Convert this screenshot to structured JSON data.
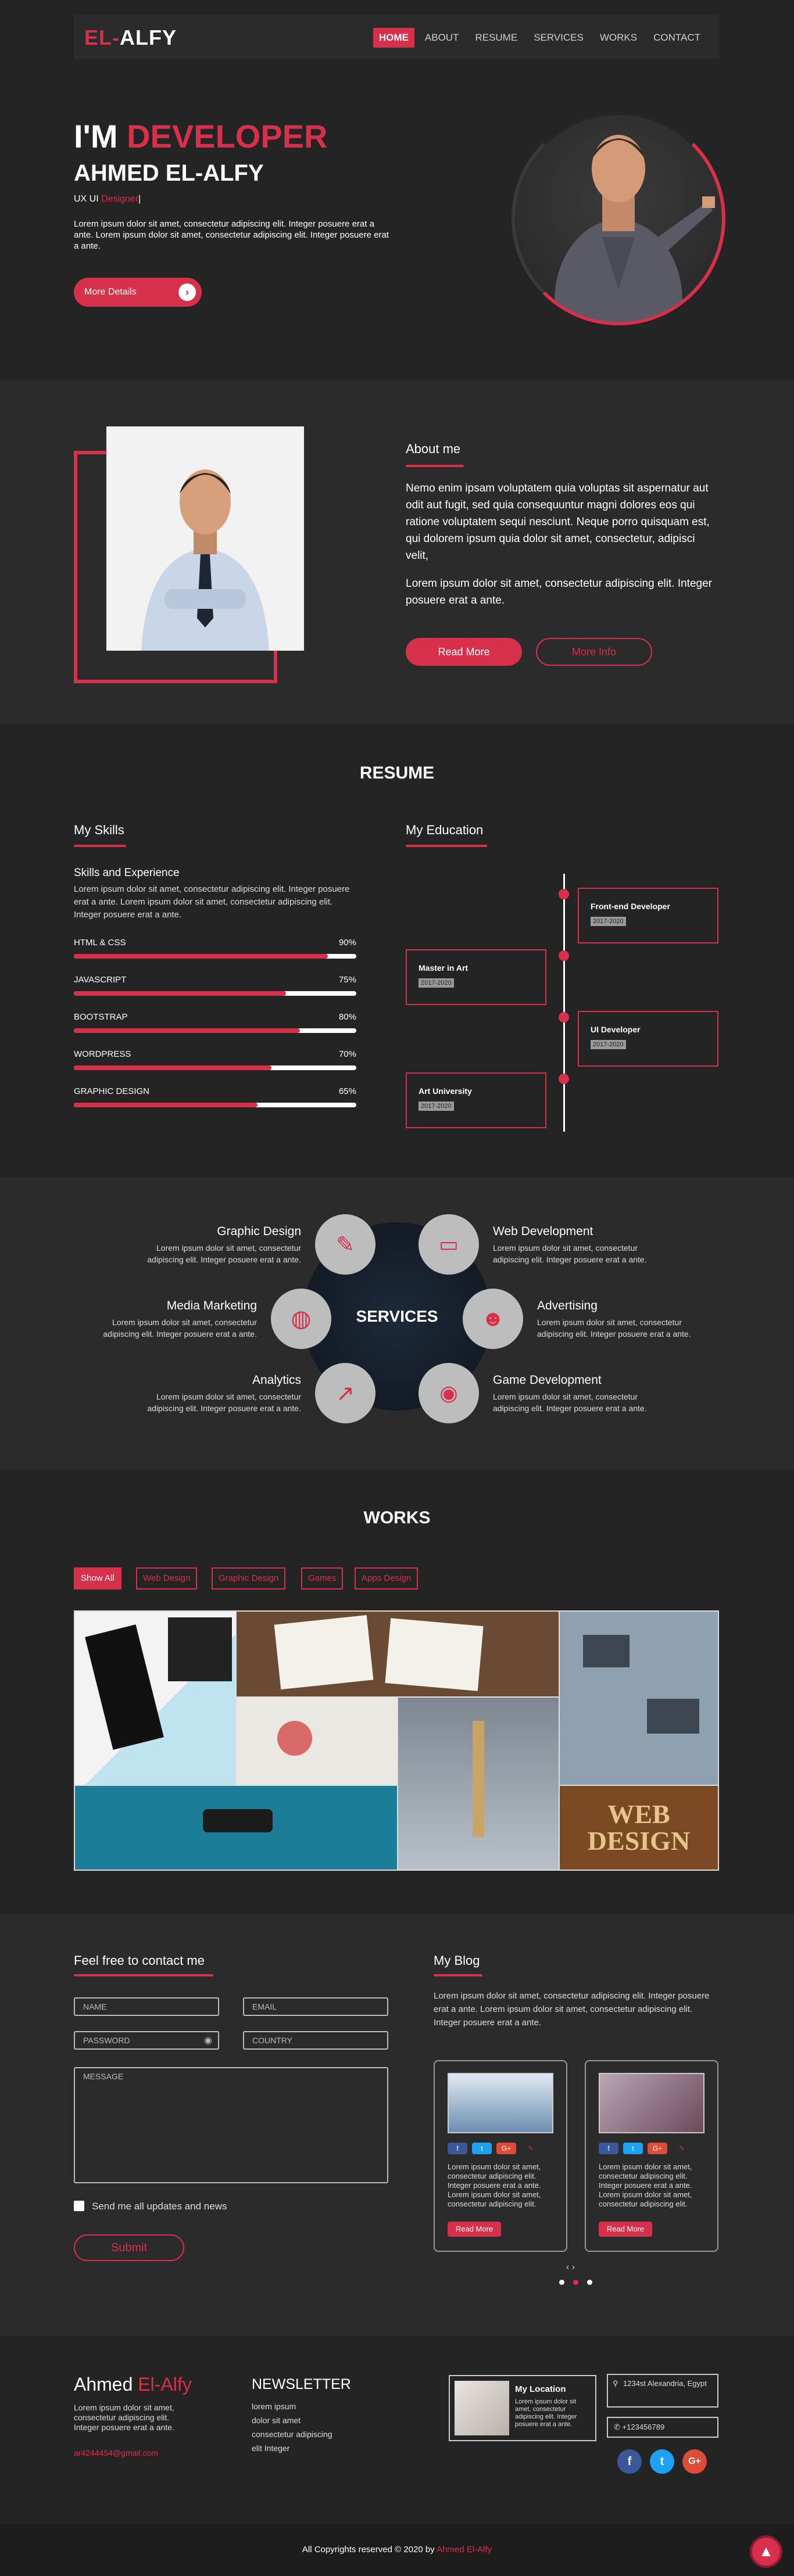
{
  "nav": {
    "logo_a": "EL-",
    "logo_b": "ALFY",
    "items": [
      "HOME",
      "ABOUT",
      "RESUME",
      "SERVICES",
      "WORKS",
      "CONTACT"
    ]
  },
  "hero": {
    "line1_a": "I'M ",
    "line1_b": "DEVELOPER",
    "name": "AHMED EL-ALFY",
    "role_a": "UX UI ",
    "role_b": "Designer",
    "cursor": "|",
    "text": "Lorem ipsum dolor sit amet, consectetur adipiscing elit. Integer posuere erat a ante. Lorem ipsum dolor sit amet, consectetur adipiscing elit. Integer posuere erat a ante.",
    "btn": "More Details"
  },
  "about": {
    "title": "About me",
    "p1": "Nemo enim ipsam voluptatem quia voluptas sit aspernatur aut odit aut fugit, sed quia consequuntur magni dolores eos qui ratione voluptatem sequi nesciunt. Neque porro quisquam est, qui dolorem ipsum quia dolor sit amet, consectetur, adipisci velit,",
    "p2": "Lorem ipsum dolor sit amet, consectetur adipiscing elit. Integer posuere erat a ante.",
    "read": "Read More",
    "info": "More Info"
  },
  "resume": {
    "title": "RESUME",
    "skills_title": "My Skills",
    "sub": "Skills and Experience",
    "text": "Lorem ipsum dolor sit amet, consectetur adipiscing elit. Integer posuere erat a ante. Lorem ipsum dolor sit amet, consectetur adipiscing elit. Integer posuere erat a ante.",
    "skills": [
      {
        "name": "HTML & CSS",
        "pct": "90%",
        "v": 0.9
      },
      {
        "name": "JAVASCRIPT",
        "pct": "75%",
        "v": 0.75
      },
      {
        "name": "BOOTSTRAP",
        "pct": "80%",
        "v": 0.8
      },
      {
        "name": "WORDPRESS",
        "pct": "70%",
        "v": 0.7
      },
      {
        "name": "GRAPHIC DESIGN",
        "pct": "65%",
        "v": 0.65
      }
    ],
    "edu_title": "My Education",
    "edu": [
      {
        "t": "Front-end Developer",
        "d": "2017-2020"
      },
      {
        "t": "Master in Art",
        "d": "2017-2020"
      },
      {
        "t": "UI Developer",
        "d": "2017-2020"
      },
      {
        "t": "Art University",
        "d": "2017-2020"
      }
    ]
  },
  "services": {
    "title": "SERVICES",
    "desc": "Lorem ipsum dolor sit amet, consectetur adipiscing elit. Integer posuere erat a ante.",
    "items": [
      "Graphic Design",
      "Web Development",
      "Media Marketing",
      "Advertising",
      "Analytics",
      "Game Development"
    ]
  },
  "works": {
    "title": "WORKS",
    "filters": [
      "Show All",
      "Web Design",
      "Graphic Design",
      "Games",
      "Apps Design"
    ],
    "web_design_word": "WEB DESIGN"
  },
  "contact": {
    "title": "Feel free to contact me",
    "name": "NAME",
    "email": "EMAIL",
    "password": "PASSWORD",
    "country": "COUNTRY",
    "message": "MESSAGE",
    "check": "Send me all updates and news",
    "submit": "Submit"
  },
  "blog": {
    "title": "My Blog",
    "text": "Lorem ipsum dolor sit amet, consectetur adipiscing elit. Integer posuere erat a ante. Lorem ipsum dolor sit amet, consectetur adipiscing elit. Integer posuere erat a ante.",
    "card_text": "Lorem ipsum dolor sit amet, consectetur adipiscing elit. Integer posuere erat a ante. Lorem ipsum dolor sit amet, consectetur adipiscing elit.",
    "card_btn": "Read More",
    "arrows": "‹ ›"
  },
  "footer": {
    "name_a": "Ahmed ",
    "name_b": "El-Alfy",
    "text": "Lorem ipsum dolor sit amet, consectetur adipiscing elit. Integer posuere erat a ante.",
    "email": "ar4244454@gmail.com",
    "news": "NEWSLETTER",
    "news_lines": [
      "lorem ipsum",
      "dolor sit amet",
      "consectetur adipiscing",
      "elit Integer"
    ],
    "loc_title": "My Location",
    "loc_text": "Lorem ipsum dolor sit amet, consectetur adipiscing elit. Integer posuere erat a ante.",
    "address": "1234st Alexandria, Egypt",
    "phone": "+123456789",
    "copy_a": "All Copyrights reserved © 2020 by ",
    "copy_b": "Ahmed El-Alfy"
  },
  "colors": {
    "accent": "#d6304a",
    "bg": "#242424",
    "alt": "#2b2b2b"
  }
}
